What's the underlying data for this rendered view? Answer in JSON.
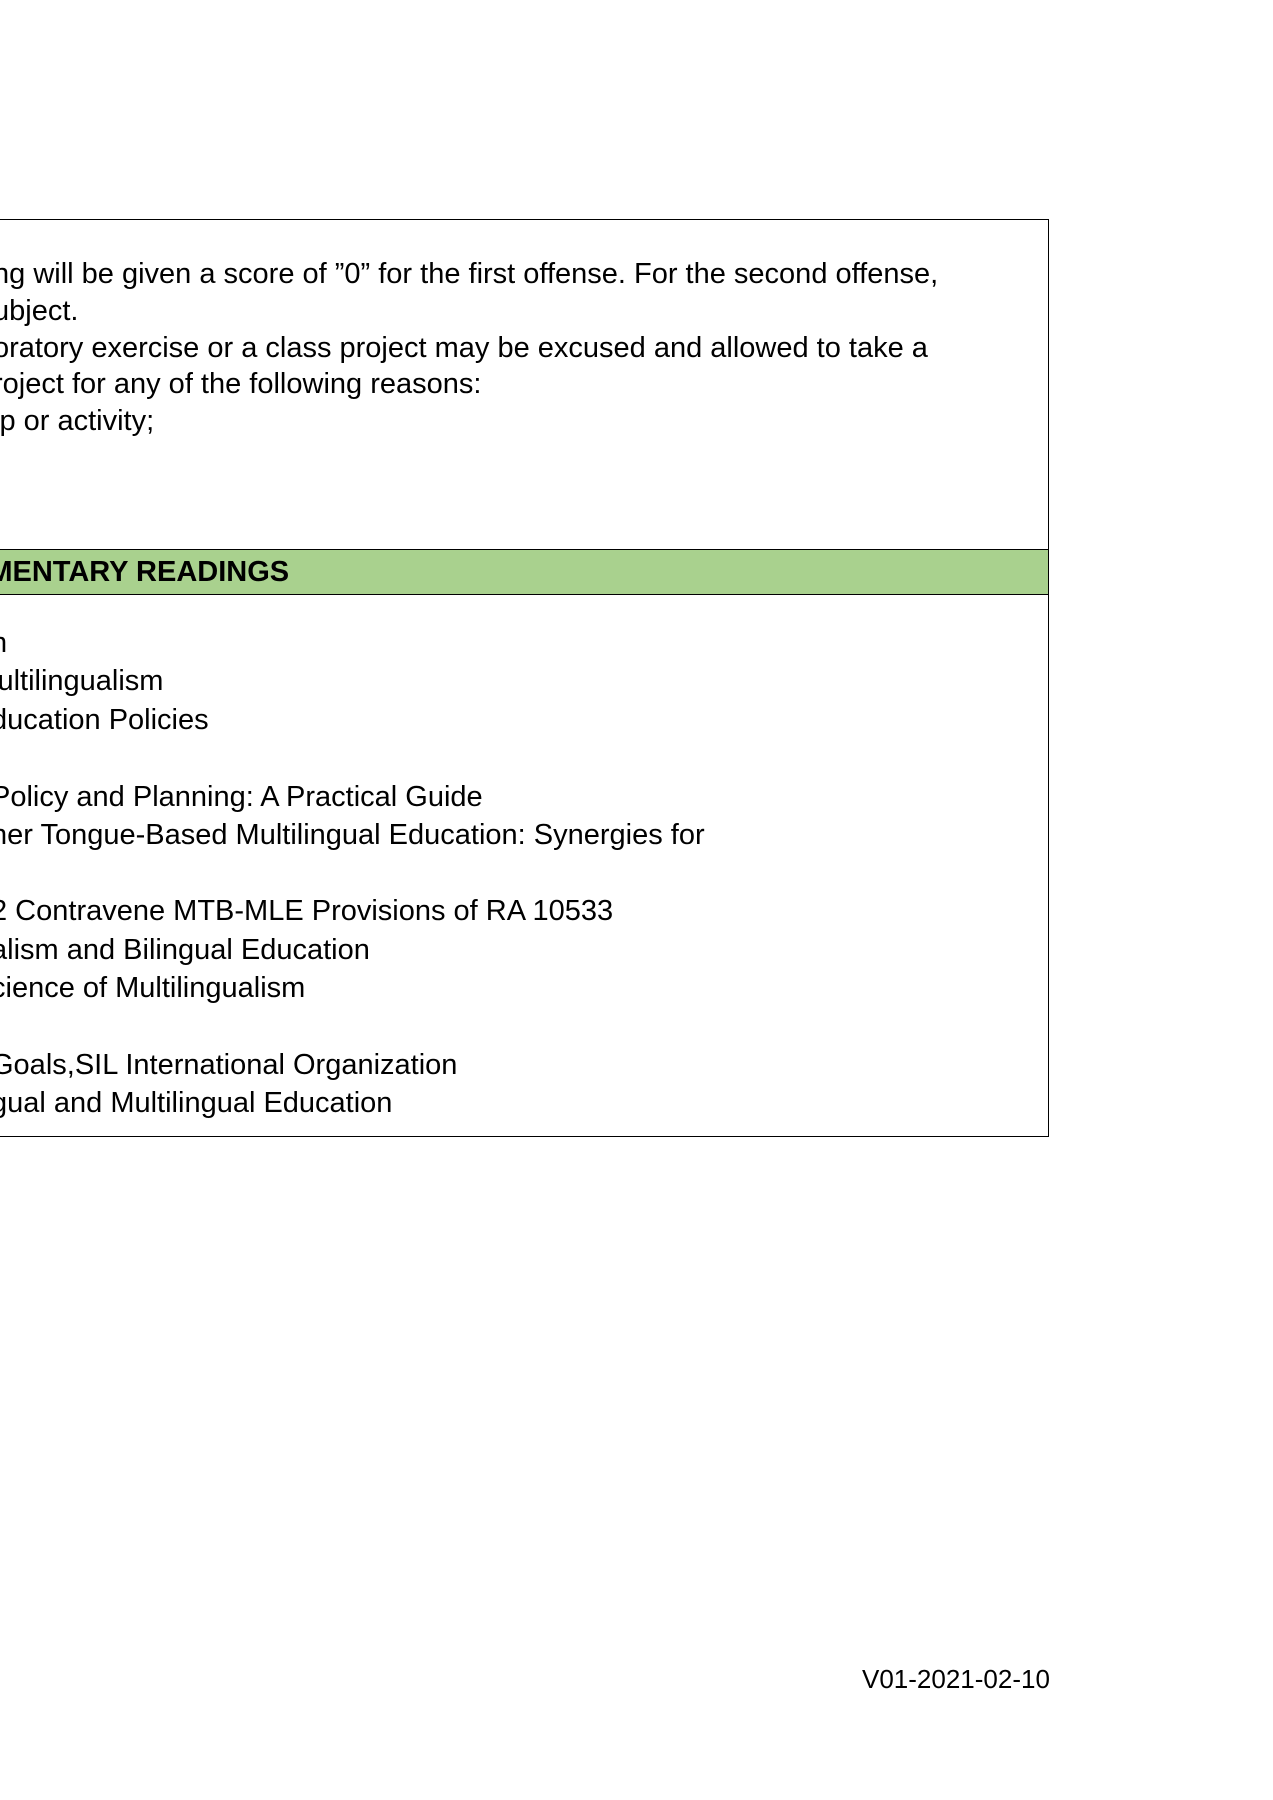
{
  "policy": {
    "lines": [
      "ng will be given a score of ”0” for the first offense. For the second offense,",
      "ubject.",
      "oratory exercise or a class project may be excused and allowed to take a",
      "roject for any of the following reasons:",
      "ip or activity;"
    ]
  },
  "readings": {
    "header": "EMENTARY READINGS",
    "lines": [
      "h",
      "lultilingualism",
      "ducation Policies",
      " Policy and Planning: A Practical Guide",
      "ner  Tongue-Based  Multilingual  Education:  Synergies  for",
      "2 Contravene MTB-MLE Provisions of RA 10533",
      "alism and Bilingual Education",
      "cience of Multilingualism",
      "Goals,SIL International Organization",
      "gual and Multilingual Education"
    ]
  },
  "footer": {
    "version": "V01-2021-02-10"
  }
}
